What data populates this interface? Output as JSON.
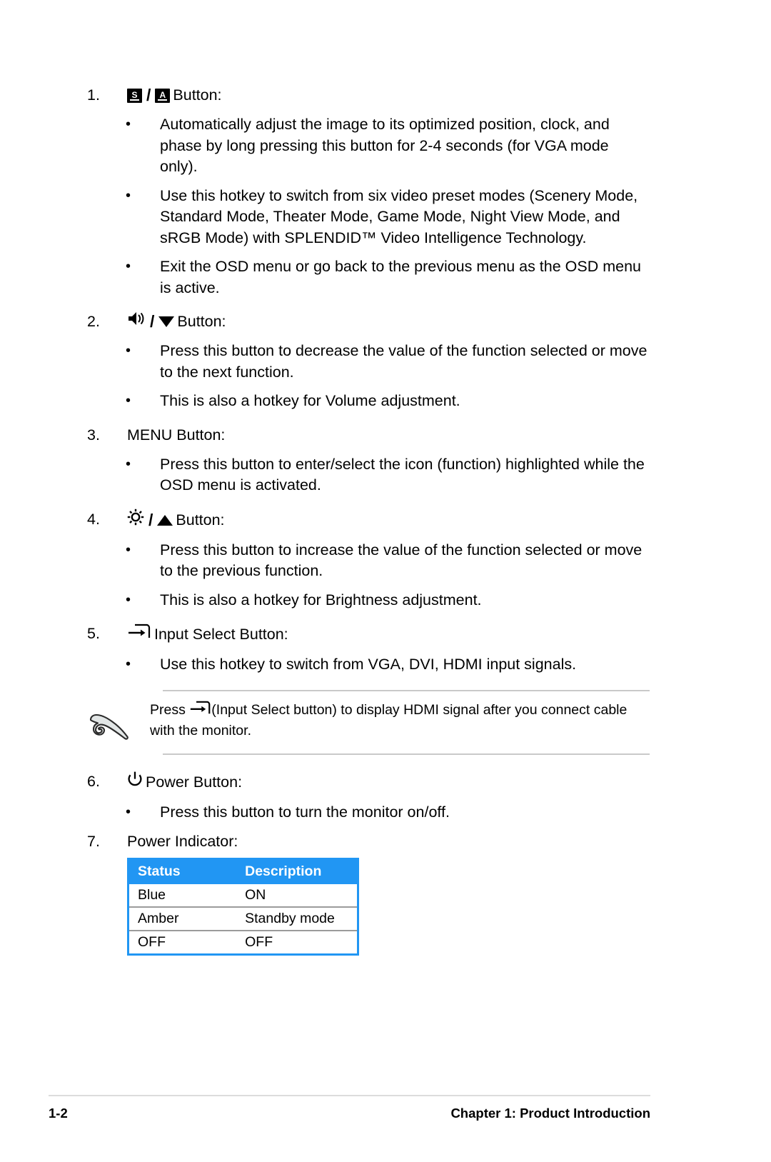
{
  "page": {
    "footer_page_number": "1-2",
    "footer_chapter": "Chapter 1: Product Introduction"
  },
  "colors": {
    "table_header_bg": "#2196f3",
    "table_header_text": "#ffffff",
    "rule": "#c9c9c9",
    "footer_rule": "#dcdcdc",
    "icon_black": "#000000",
    "hand_fill": "#e2e6e6"
  },
  "items": [
    {
      "number": "1.",
      "icons": [
        "splendid-s-key-icon",
        "auto-a-key-icon"
      ],
      "separator": "/",
      "title": "Button:",
      "bullets": [
        "Automatically adjust the image to its optimized position, clock, and phase by long pressing this button for 2-4 seconds (for VGA mode only).",
        "Use this hotkey to switch from six video preset modes (Scenery Mode, Standard Mode, Theater Mode, Game Mode, Night View Mode, and sRGB Mode) with SPLENDID™ Video Intelligence Technology.",
        "Exit the OSD menu or go back to the previous menu as the OSD menu is active."
      ]
    },
    {
      "number": "2.",
      "icons": [
        "volume-speaker-icon",
        "triangle-down-icon"
      ],
      "separator": "/",
      "title": "Button:",
      "bullets": [
        "Press this button to decrease the value of the function selected or move to the next function.",
        "This is also a hotkey for Volume adjustment."
      ]
    },
    {
      "number": "3.",
      "icons": [],
      "separator": "",
      "title": "MENU Button:",
      "bullets": [
        "Press this button to enter/select the icon (function) highlighted while the OSD menu is activated."
      ]
    },
    {
      "number": "4.",
      "icons": [
        "brightness-sun-icon",
        "triangle-up-icon"
      ],
      "separator": "/",
      "title": "Button:",
      "bullets": [
        "Press this button to increase the value of the function selected or move to the previous function.",
        "This is also a hotkey for Brightness adjustment."
      ]
    },
    {
      "number": "5.",
      "icons": [
        "input-select-icon"
      ],
      "separator": "",
      "title": "Input Select Button:",
      "bullets": [
        "Use this hotkey to switch from VGA, DVI, HDMI input signals."
      ]
    },
    {
      "number": "6.",
      "icons": [
        "power-icon"
      ],
      "separator": "",
      "title": "Power Button:",
      "bullets": [
        "Press this button to turn the monitor on/off."
      ]
    },
    {
      "number": "7.",
      "icons": [],
      "separator": "",
      "title": "Power Indicator:",
      "bullets": []
    }
  ],
  "note": {
    "icon": "pointing-hand-icon",
    "text_before_icon": "Press",
    "inline_icon": "input-select-icon",
    "text_after_icon": "(Input Select button) to display HDMI signal after you connect cable with the monitor."
  },
  "indicator_table": {
    "headers": [
      "Status",
      "Description"
    ],
    "rows": [
      [
        "Blue",
        "ON"
      ],
      [
        "Amber",
        "Standby mode"
      ],
      [
        "OFF",
        "OFF"
      ]
    ]
  }
}
